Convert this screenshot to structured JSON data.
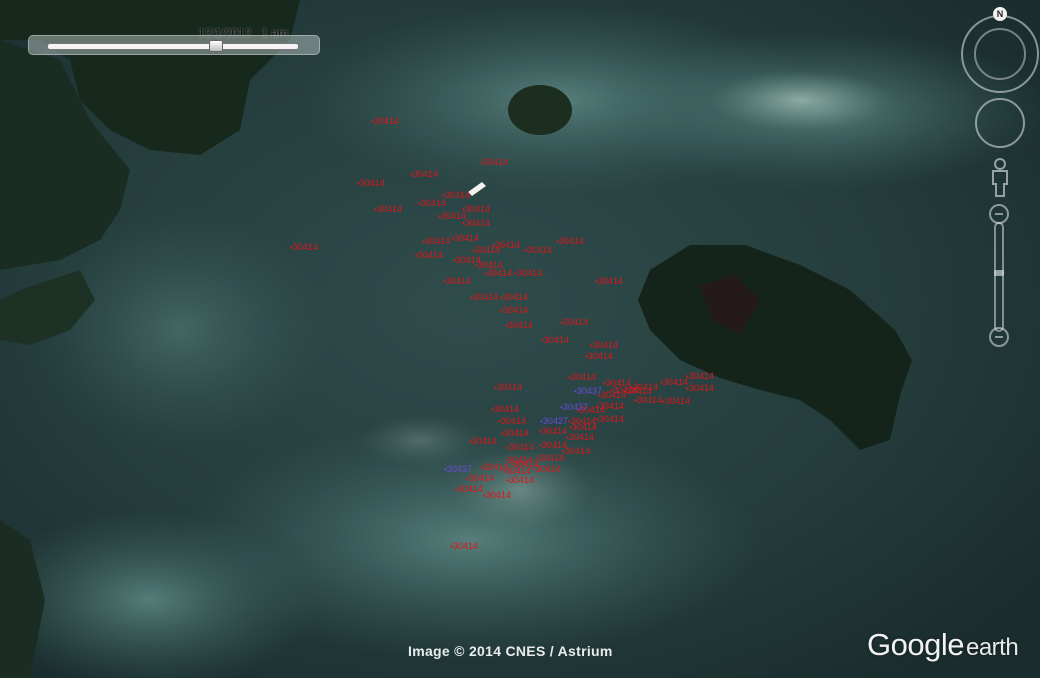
{
  "time_slider": {
    "label": "12/1/2012   1 am",
    "position": 0.66
  },
  "navigation": {
    "north_label": "N",
    "compass_icon": "compass-ring-icon",
    "look_icon": "look-joystick-icon",
    "pegman_icon": "street-view-pegman-icon",
    "zoom_icon": "zoom-slider-icon"
  },
  "markers": {
    "red_color": "#e0141a",
    "purple_color": "#6a4bd8",
    "items": [
      {
        "label": "30414",
        "color": "red"
      },
      {
        "label": "30414",
        "color": "red"
      },
      {
        "label": "30414",
        "color": "red"
      },
      {
        "label": "30414",
        "color": "red"
      },
      {
        "label": "30414",
        "color": "red"
      },
      {
        "label": "30414",
        "color": "red"
      },
      {
        "label": "30414",
        "color": "red"
      },
      {
        "label": "30414",
        "color": "red"
      },
      {
        "label": "30414",
        "color": "red"
      },
      {
        "label": "30414",
        "color": "red"
      },
      {
        "label": "30414",
        "color": "red"
      },
      {
        "label": "30414",
        "color": "red"
      },
      {
        "label": "30414",
        "color": "red"
      },
      {
        "label": "30414",
        "color": "red"
      },
      {
        "label": "30414",
        "color": "red"
      },
      {
        "label": "30414",
        "color": "red"
      },
      {
        "label": "30414",
        "color": "red"
      },
      {
        "label": "30414",
        "color": "red"
      },
      {
        "label": "30414",
        "color": "red"
      },
      {
        "label": "30414",
        "color": "red"
      },
      {
        "label": "30414",
        "color": "red"
      },
      {
        "label": "30414",
        "color": "red"
      },
      {
        "label": "30414",
        "color": "red"
      },
      {
        "label": "30414",
        "color": "red"
      },
      {
        "label": "30414",
        "color": "red"
      },
      {
        "label": "30414",
        "color": "red"
      },
      {
        "label": "30414",
        "color": "red"
      },
      {
        "label": "30414",
        "color": "red"
      },
      {
        "label": "30414",
        "color": "red"
      },
      {
        "label": "30414",
        "color": "red"
      },
      {
        "label": "30414",
        "color": "red"
      },
      {
        "label": "30414",
        "color": "red"
      },
      {
        "label": "30414",
        "color": "red"
      },
      {
        "label": "30414",
        "color": "red"
      },
      {
        "label": "30414",
        "color": "red"
      },
      {
        "label": "30414",
        "color": "red"
      },
      {
        "label": "30414",
        "color": "red"
      },
      {
        "label": "30414",
        "color": "red"
      },
      {
        "label": "30414",
        "color": "red"
      },
      {
        "label": "30414",
        "color": "red"
      },
      {
        "label": "30414",
        "color": "red"
      },
      {
        "label": "30414",
        "color": "red"
      },
      {
        "label": "30414",
        "color": "red"
      },
      {
        "label": "30414",
        "color": "red"
      },
      {
        "label": "30414",
        "color": "red"
      },
      {
        "label": "30414",
        "color": "red"
      },
      {
        "label": "30414",
        "color": "red"
      },
      {
        "label": "30414",
        "color": "red"
      },
      {
        "label": "30414",
        "color": "red"
      },
      {
        "label": "30414",
        "color": "red"
      },
      {
        "label": "30414",
        "color": "red"
      },
      {
        "label": "30414",
        "color": "red"
      },
      {
        "label": "30414",
        "color": "red"
      },
      {
        "label": "30414",
        "color": "red"
      },
      {
        "label": "30414",
        "color": "red"
      },
      {
        "label": "30414",
        "color": "red"
      },
      {
        "label": "30414",
        "color": "red"
      },
      {
        "label": "30414",
        "color": "red"
      },
      {
        "label": "30414",
        "color": "red"
      },
      {
        "label": "30414",
        "color": "red"
      },
      {
        "label": "30414",
        "color": "red"
      },
      {
        "label": "30414",
        "color": "red"
      },
      {
        "label": "30414",
        "color": "red"
      },
      {
        "label": "30414",
        "color": "red"
      },
      {
        "label": "30414",
        "color": "red"
      },
      {
        "label": "30414",
        "color": "red"
      },
      {
        "label": "30414",
        "color": "red"
      },
      {
        "label": "30414",
        "color": "red"
      },
      {
        "label": "30414",
        "color": "red"
      },
      {
        "label": "30437",
        "color": "purple"
      },
      {
        "label": "30437",
        "color": "purple"
      },
      {
        "label": "30427",
        "color": "purple"
      },
      {
        "label": "30437",
        "color": "purple"
      }
    ]
  },
  "credit": "Image © 2014 CNES / Astrium",
  "logo": {
    "google": "Google",
    "earth": "earth"
  },
  "colors": {
    "water_dark": "#1c2f30",
    "water_teal": "#3d6a68",
    "land_dark": "#16251c",
    "reef_light": "#8aa7a0"
  }
}
